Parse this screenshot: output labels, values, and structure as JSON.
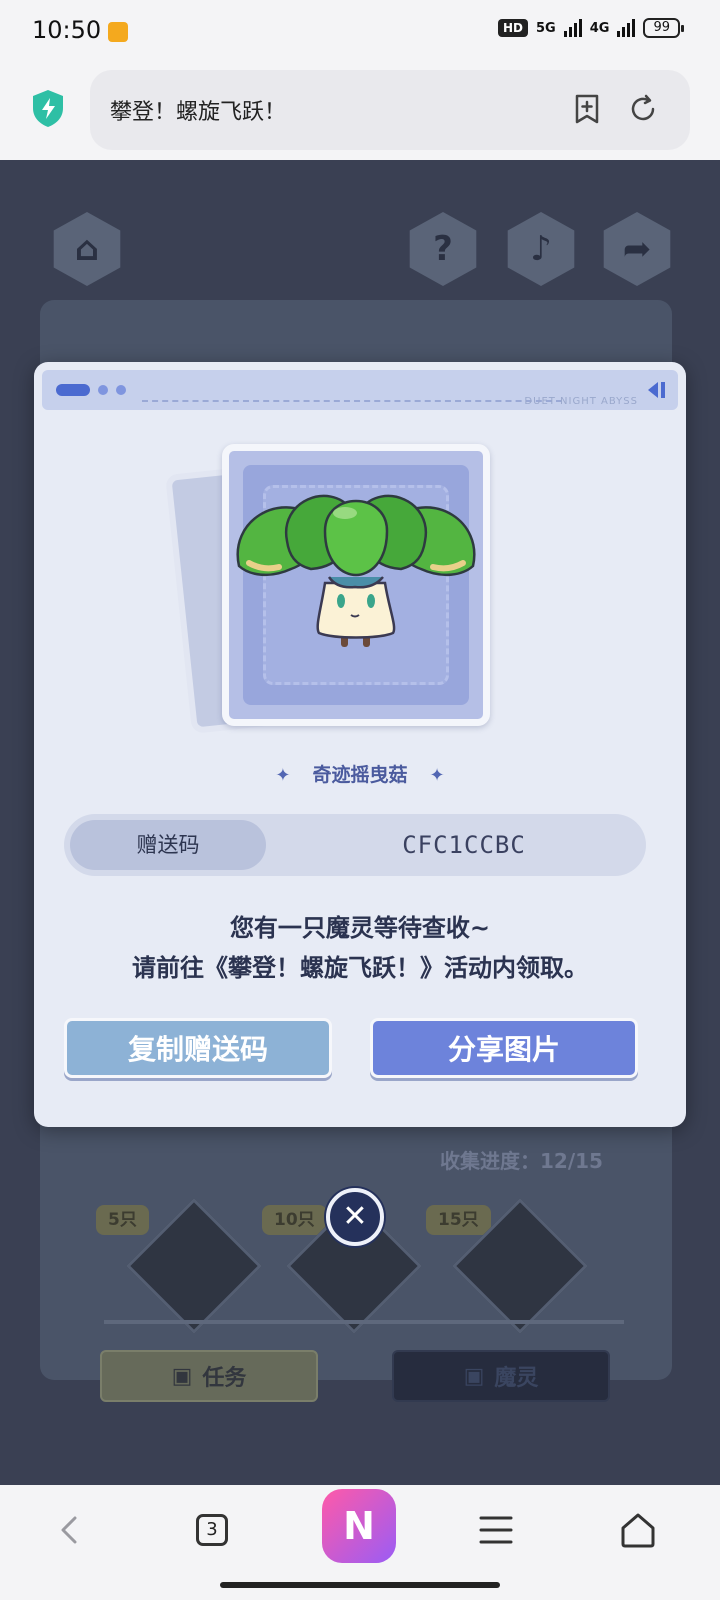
{
  "status": {
    "time": "10:50",
    "hd_label": "HD",
    "net1": "5G",
    "net2": "4G",
    "battery": "99"
  },
  "browser": {
    "title": "攀登！螺旋飞跃！",
    "tab_count": "3",
    "ai_label": "N"
  },
  "game_bg": {
    "progress": "收集进度：12/15",
    "badges": [
      "5只",
      "10只",
      "15只"
    ],
    "tab_task": "任务",
    "tab_spirit": "魔灵"
  },
  "modal": {
    "brand": "DUET NIGHT ABYSS",
    "character_name": "奇迹摇曳菇",
    "code_label": "赠送码",
    "code_value": "CFC1CCBC",
    "message_line1": "您有一只魔灵等待查收~",
    "message_line2": "请前往《攀登！螺旋飞跃！》活动内领取。",
    "copy_button": "复制赠送码",
    "share_button": "分享图片"
  },
  "colors": {
    "accent": "#6d83db",
    "copy_button": "#8db2d6",
    "modal_bg": "#e7ebf5",
    "close_button": "#25315b"
  }
}
